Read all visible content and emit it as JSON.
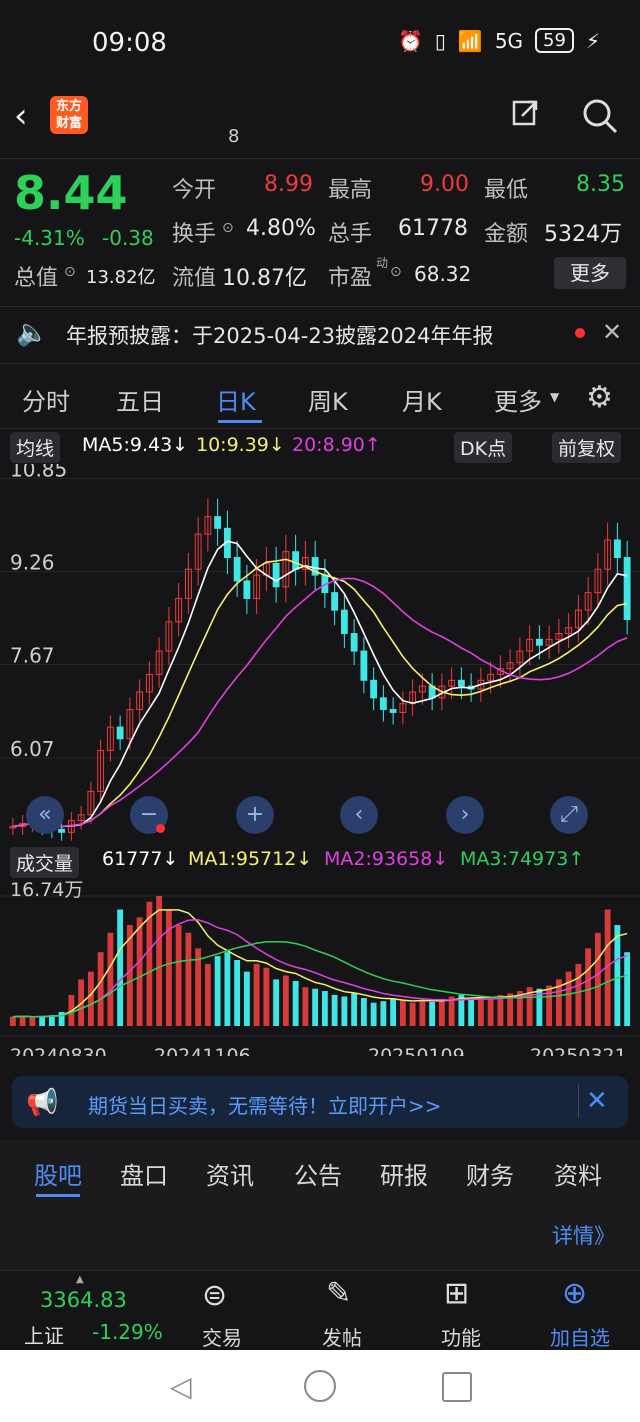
{
  "status": {
    "time": "09:08",
    "battery": "59",
    "signal": "5G"
  },
  "header": {
    "logo": "东方财富",
    "code": "8"
  },
  "quote": {
    "price": "8.44",
    "pct": "-4.31%",
    "change": "-0.38",
    "open_label": "今开",
    "open": "8.99",
    "high_label": "最高",
    "high": "9.00",
    "low_label": "最低",
    "low": "8.35",
    "turnover_label": "换手",
    "turnover": "4.80%",
    "vol_label": "总手",
    "vol": "61778",
    "amount_label": "金额",
    "amount": "5324万",
    "mcap_label": "总值",
    "mcap": "13.82亿",
    "float_label": "流值",
    "float": "10.87亿",
    "pe_label": "市盈",
    "pe_sup": "动",
    "pe": "68.32",
    "more": "更多"
  },
  "notice": {
    "text": "年报预披露：于2025-04-23披露2024年年报"
  },
  "chart_tabs": [
    "分时",
    "五日",
    "日K",
    "周K",
    "月K",
    "更多"
  ],
  "kline": {
    "ma_toggle": "均线",
    "ma5": "MA5:9.43↓",
    "ma10": "10:9.39↓",
    "ma20": "20:8.90↑",
    "dk": "DK点",
    "fq": "前复权"
  },
  "volume_bar": {
    "label": "成交量",
    "v": "61777↓",
    "ma1": "MA1:95712↓",
    "ma2": "MA2:93658↓",
    "ma3": "MA3:74973↑"
  },
  "banner": {
    "text": "期货当日买卖，无需等待！立即开户>>"
  },
  "bottom_tabs": [
    "股吧",
    "盘口",
    "资讯",
    "公告",
    "研报",
    "财务",
    "资料"
  ],
  "detail": "详情》",
  "dock": {
    "index_value": "3364.83",
    "index_name": "上证",
    "index_pct": "-1.29%",
    "items": [
      "交易",
      "发帖",
      "功能",
      "加自选"
    ]
  },
  "colors": {
    "up": "#ef3b3b",
    "down": "#2fd05a",
    "ma5": "#ffffff",
    "ma10": "#f5ef6b",
    "ma20": "#e040e0",
    "accent": "#4d8cf5"
  },
  "chart_data": {
    "type": "candlestick",
    "yticks": [
      "10.85",
      "9.26",
      "7.67",
      "6.07"
    ],
    "ylim": [
      4.6,
      11.1
    ],
    "xticks": [
      "20240830",
      "20241106",
      "20250109",
      "20250321"
    ],
    "close": [
      4.9,
      4.95,
      5.0,
      4.9,
      4.85,
      4.8,
      5.0,
      5.1,
      5.5,
      6.2,
      6.6,
      6.4,
      6.9,
      7.2,
      7.5,
      7.9,
      8.4,
      8.8,
      9.3,
      9.9,
      10.2,
      10.0,
      9.5,
      9.1,
      8.8,
      9.2,
      9.4,
      9.0,
      9.6,
      9.3,
      9.5,
      9.2,
      8.9,
      8.6,
      8.2,
      7.9,
      7.4,
      7.1,
      6.9,
      6.85,
      7.0,
      7.2,
      7.3,
      7.1,
      7.3,
      7.4,
      7.3,
      7.25,
      7.4,
      7.5,
      7.6,
      7.7,
      7.9,
      8.1,
      8.0,
      8.1,
      8.2,
      8.3,
      8.6,
      8.9,
      9.3,
      9.8,
      9.5,
      8.44
    ],
    "volume_ylim": [
      0,
      167400
    ],
    "volume_ylabel": "16.74万",
    "volume": [
      12000,
      13000,
      11000,
      12500,
      14000,
      18000,
      40000,
      60000,
      70000,
      95000,
      120000,
      150000,
      130000,
      140000,
      160000,
      167400,
      150000,
      130000,
      120000,
      100000,
      80000,
      90000,
      95000,
      85000,
      70000,
      80000,
      75000,
      60000,
      65000,
      58000,
      50000,
      48000,
      45000,
      40000,
      38000,
      42000,
      36000,
      30000,
      32000,
      35000,
      34000,
      30000,
      33000,
      31000,
      35000,
      38000,
      40000,
      36000,
      34000,
      37000,
      40000,
      42000,
      45000,
      50000,
      48000,
      52000,
      60000,
      70000,
      80000,
      100000,
      120000,
      150000,
      130000,
      95000
    ]
  }
}
